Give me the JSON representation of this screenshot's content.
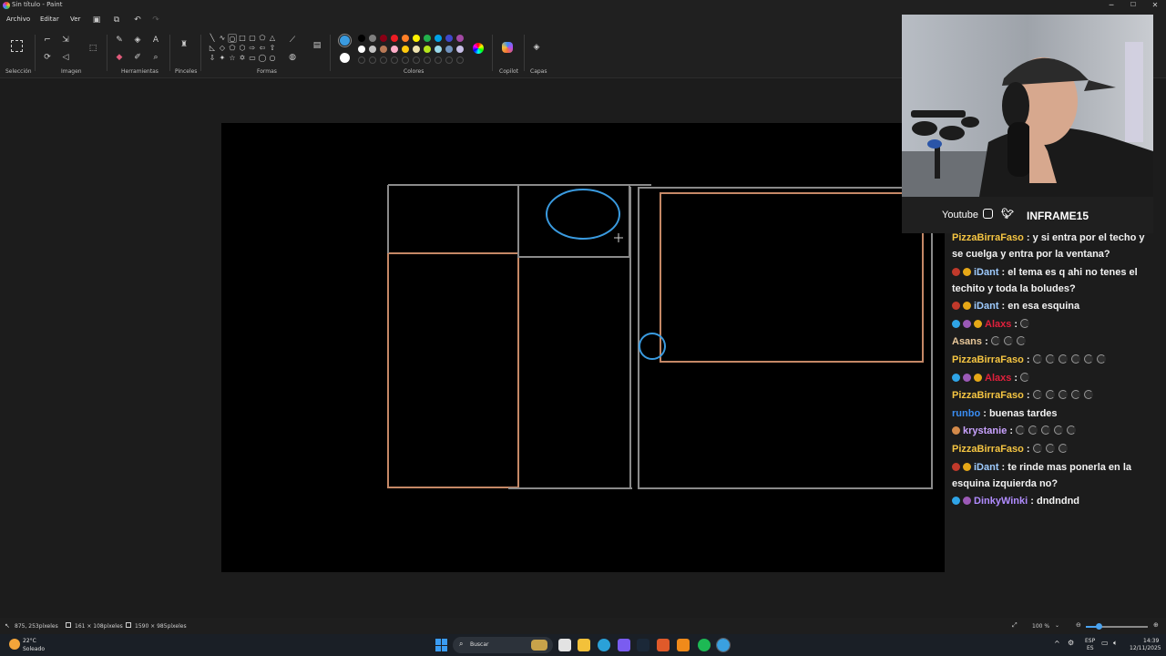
{
  "window": {
    "title": "Sin título - Paint",
    "min": "─",
    "max": "☐",
    "close": "✕"
  },
  "menu": {
    "items": [
      "Archivo",
      "Editar",
      "Ver"
    ]
  },
  "ribbon": {
    "groups": {
      "seleccion": "Selección",
      "imagen": "Imagen",
      "herramientas": "Herramientas",
      "pinceles": "Pinceles",
      "formas": "Formas",
      "colores": "Colores",
      "copilot": "Copilot",
      "capas": "Capas"
    },
    "primary_color": "#3a9be0",
    "secondary_color": "#ffffff",
    "palette_row1": [
      "#000000",
      "#7f7f7f",
      "#880015",
      "#ed1c24",
      "#ff7f27",
      "#fff200",
      "#22b14c",
      "#00a2e8",
      "#3f48cc",
      "#a349a4"
    ],
    "palette_row2": [
      "#ffffff",
      "#c3c3c3",
      "#b97a57",
      "#ffaec9",
      "#ffc90e",
      "#efe4b0",
      "#b5e61d",
      "#99d9ea",
      "#7092be",
      "#c8bfe7"
    ]
  },
  "status": {
    "cursor": "875, 253píxeles",
    "selection": "161 × 108píxeles",
    "canvas_size": "1590 × 985píxeles",
    "zoom": "100 %"
  },
  "taskbar": {
    "weather_temp": "22°C",
    "weather_desc": "Soleado",
    "search": "Buscar",
    "lang1": "ESP",
    "lang2": "ES",
    "time": "14:39",
    "date": "12/11/2025"
  },
  "stream": {
    "youtube": "Youtube",
    "channel": "INFRAME15"
  },
  "chat": [
    {
      "user": "PizzaBirraFaso",
      "color": "#f5c542",
      "badges": [],
      "text": ": y si entra por el techo y se cuelga y entra por la ventana?",
      "emotes": 0
    },
    {
      "user": "iDant",
      "color": "#9ecbff",
      "badges": [
        "#c0392b",
        "#e6a817"
      ],
      "text": ": el tema es q ahi no tenes el techito y toda la boludes?",
      "emotes": 0
    },
    {
      "user": "iDant",
      "color": "#9ecbff",
      "badges": [
        "#c0392b",
        "#e6a817"
      ],
      "text": ": en esa esquina",
      "emotes": 0
    },
    {
      "user": "Alaxs",
      "color": "#e0203c",
      "badges": [
        "#2fa4e7",
        "#9b59b6",
        "#e6a817"
      ],
      "text": ":",
      "emotes": 1
    },
    {
      "user": "Asans",
      "color": "#e9c89a",
      "badges": [],
      "text": ":",
      "emotes": 3
    },
    {
      "user": "PizzaBirraFaso",
      "color": "#f5c542",
      "badges": [],
      "text": ":",
      "emotes": 6
    },
    {
      "user": "Alaxs",
      "color": "#e0203c",
      "badges": [
        "#2fa4e7",
        "#9b59b6",
        "#e6a817"
      ],
      "text": ":",
      "emotes": 1
    },
    {
      "user": "PizzaBirraFaso",
      "color": "#f5c542",
      "badges": [],
      "text": ":",
      "emotes": 5
    },
    {
      "user": "runbo",
      "color": "#3a8df3",
      "badges": [],
      "text": ": buenas tardes",
      "emotes": 0
    },
    {
      "user": "krystanie",
      "color": "#c9a2ff",
      "badges": [
        "#d48a4a"
      ],
      "text": ":",
      "emotes": 5
    },
    {
      "user": "PizzaBirraFaso",
      "color": "#f5c542",
      "badges": [],
      "text": ":",
      "emotes": 3
    },
    {
      "user": "iDant",
      "color": "#9ecbff",
      "badges": [
        "#c0392b",
        "#e6a817"
      ],
      "text": ": te rinde mas ponerla en la esquina izquierda no?",
      "emotes": 0
    },
    {
      "user": "DinkyWinki",
      "color": "#b18cff",
      "badges": [
        "#2fa4e7",
        "#9b59b6"
      ],
      "text": ": dndndnd",
      "emotes": 0
    }
  ]
}
